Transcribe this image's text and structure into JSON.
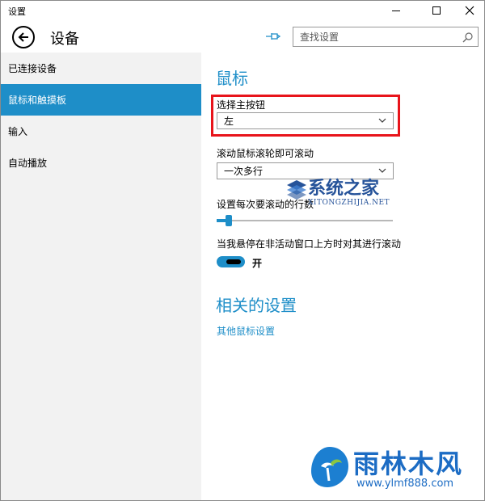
{
  "window": {
    "title": "设置"
  },
  "header": {
    "page_title": "设备",
    "search_placeholder": "查找设置"
  },
  "sidebar": {
    "items": [
      {
        "label": "已连接设备"
      },
      {
        "label": "鼠标和触摸板"
      },
      {
        "label": "输入"
      },
      {
        "label": "自动播放"
      }
    ]
  },
  "main": {
    "mouse_title": "鼠标",
    "primary_button_label": "选择主按钮",
    "primary_button_value": "左",
    "scroll_label": "滚动鼠标滚轮即可滚动",
    "scroll_value": "一次多行",
    "lines_label": "设置每次要滚动的行数",
    "lines_slider_fraction": 0.07,
    "inactive_scroll_label": "当我悬停在非活动窗口上方时对其进行滚动",
    "inactive_scroll_state": "开",
    "related_title": "相关的设置",
    "other_mouse_link": "其他鼠标设置"
  },
  "watermarks": {
    "site1_name": "系统之家",
    "site1_url": "XITONGZHIJIA.NET",
    "site2_name": "雨林木风",
    "site2_url": "www.ylmf888.com"
  },
  "colors": {
    "accent": "#1e8ec8",
    "highlight": "#e8141b"
  }
}
